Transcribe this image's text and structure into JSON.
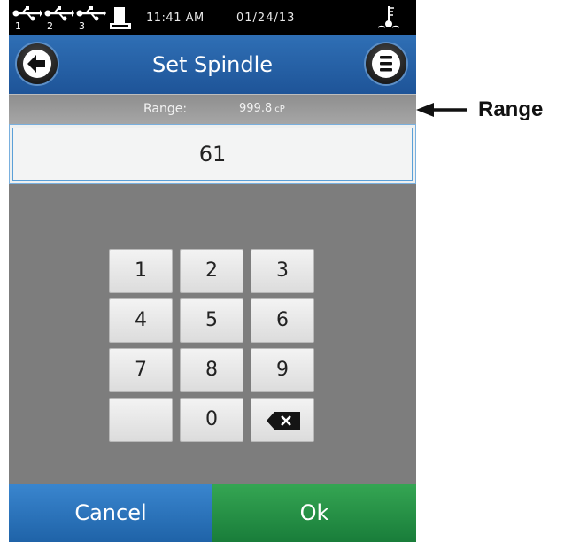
{
  "status_bar": {
    "usb_ports": [
      "1",
      "2",
      "3"
    ],
    "time": "11:41 AM",
    "date": "01/24/13",
    "icons": [
      "usb-icon",
      "printer-icon",
      "temperature-probe-icon"
    ]
  },
  "header": {
    "title": "Set Spindle",
    "back_icon": "back-arrow-icon",
    "menu_icon": "menu-icon"
  },
  "range": {
    "label": "Range:",
    "value": "999.8",
    "unit": "cP"
  },
  "input": {
    "value": "61"
  },
  "keypad": {
    "keys": [
      "1",
      "2",
      "3",
      "4",
      "5",
      "6",
      "7",
      "8",
      "9",
      "",
      "0",
      "backspace"
    ]
  },
  "footer": {
    "cancel_label": "Cancel",
    "ok_label": "Ok"
  },
  "callout": {
    "label": "Range"
  },
  "colors": {
    "title_bar": "#2f6fb5",
    "cancel": "#2a74bd",
    "ok": "#27904a",
    "panel": "#7d7d7d",
    "status_bar": "#000000"
  }
}
